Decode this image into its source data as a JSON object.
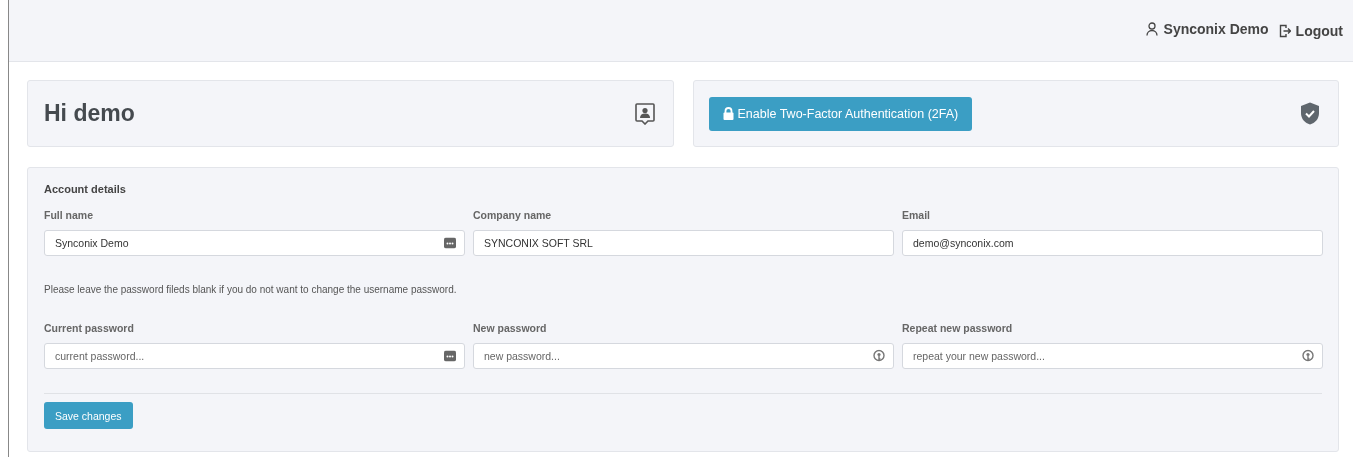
{
  "user_menu": {
    "name": "Synconix Demo",
    "logout": "Logout"
  },
  "greeting_card": {
    "title": "Hi demo"
  },
  "twofa_card": {
    "button": "Enable Two-Factor Authentication (2FA)"
  },
  "account_details": {
    "title": "Account details",
    "fields": [
      {
        "label": "Full name",
        "value": "Synconix Demo",
        "kind": "dots"
      },
      {
        "label": "Company name",
        "value": "SYNCONIX SOFT SRL",
        "kind": "plain"
      },
      {
        "label": "Email",
        "value": "demo@synconix.com",
        "kind": "plain"
      }
    ]
  },
  "password_section": {
    "note": "Please leave the password fileds blank if you do not want to change the username password.",
    "fields": [
      {
        "label": "Current password",
        "placeholder": "current password...",
        "kind": "dots"
      },
      {
        "label": "New password",
        "placeholder": "new password...",
        "kind": "key"
      },
      {
        "label": "Repeat new password",
        "placeholder": "repeat your new password...",
        "kind": "key"
      }
    ]
  },
  "save_button": "Save changes"
}
